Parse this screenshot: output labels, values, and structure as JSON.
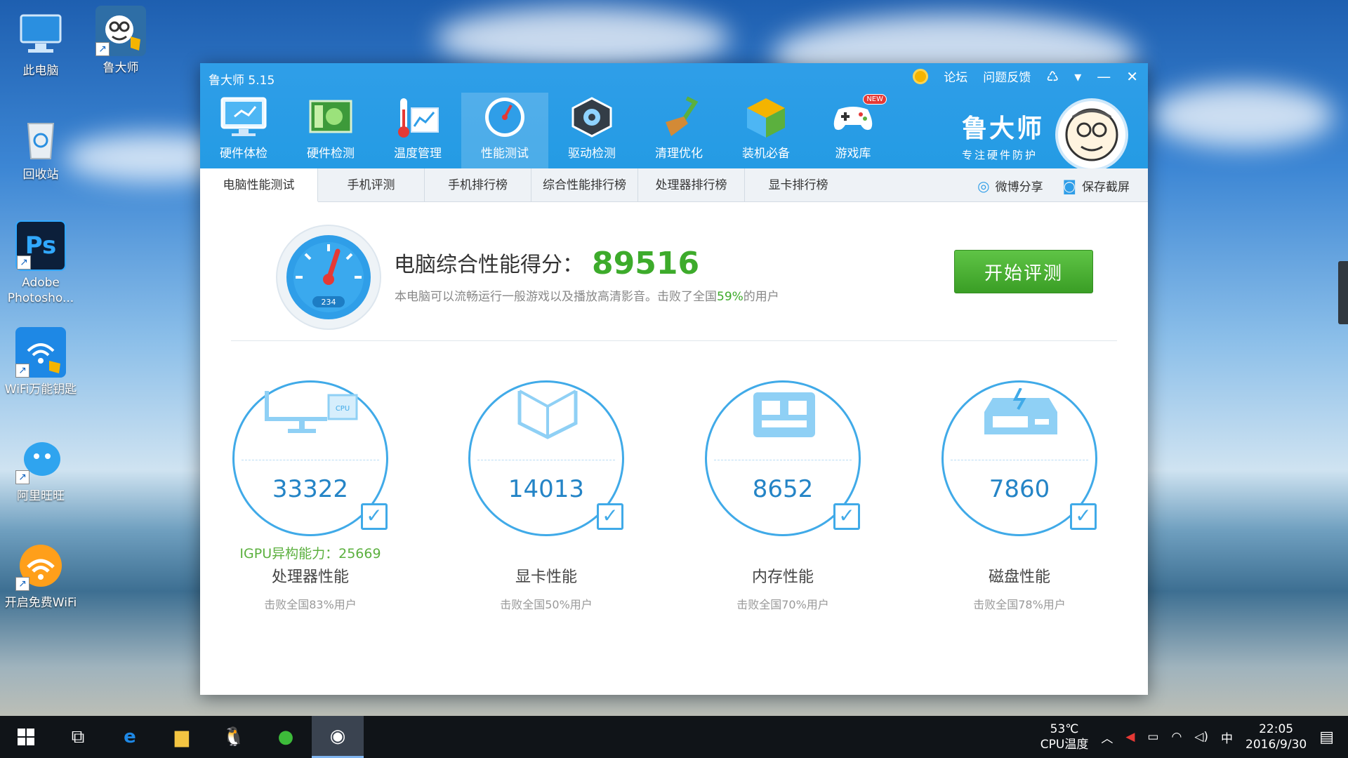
{
  "desktop": {
    "icons": [
      {
        "label": "此电脑"
      },
      {
        "label": "鲁大师"
      },
      {
        "label": "回收站"
      },
      {
        "label": "Adobe Photosho..."
      },
      {
        "label": "WiFi万能钥匙"
      },
      {
        "label": "阿里旺旺"
      },
      {
        "label": "开启免费WiFi"
      }
    ]
  },
  "window": {
    "title": "鲁大师 5.15",
    "header_links": {
      "forum": "论坛",
      "feedback": "问题反馈"
    },
    "toolbar": [
      {
        "label": "硬件体检",
        "icon": "monitor-check-icon"
      },
      {
        "label": "硬件检测",
        "icon": "circuit-board-icon"
      },
      {
        "label": "温度管理",
        "icon": "thermometer-icon"
      },
      {
        "label": "性能测试",
        "icon": "speedometer-icon"
      },
      {
        "label": "驱动检测",
        "icon": "gear-chip-icon"
      },
      {
        "label": "清理优化",
        "icon": "broom-icon"
      },
      {
        "label": "装机必备",
        "icon": "cube-box-icon"
      },
      {
        "label": "游戏库",
        "icon": "gamepad-icon",
        "badge": "NEW"
      }
    ],
    "brand": {
      "name": "鲁大师",
      "slogan": "专注硬件防护"
    },
    "tabs": [
      "电脑性能测试",
      "手机评测",
      "手机排行榜",
      "综合性能排行榜",
      "处理器排行榜",
      "显卡排行榜"
    ],
    "tab_actions": {
      "share": "微博分享",
      "screenshot": "保存截屏"
    },
    "score": {
      "gauge_label": "234",
      "title": "电脑综合性能得分：",
      "value": "89516",
      "desc_before": "本电脑可以流畅运行一般游戏以及播放高清影音。击败了全国",
      "desc_pct": "59%",
      "desc_after": "的用户",
      "start_button": "开始评测"
    },
    "cards": [
      {
        "score": "33322",
        "extra": "IGPU异构能力：25669",
        "name": "处理器性能",
        "desc": "击败全国83%用户",
        "icon": "cpu-monitor-icon"
      },
      {
        "score": "14013",
        "extra": "",
        "name": "显卡性能",
        "desc": "击败全国50%用户",
        "icon": "graphics-cube-icon"
      },
      {
        "score": "8652",
        "extra": "",
        "name": "内存性能",
        "desc": "击败全国70%用户",
        "icon": "memory-chip-icon"
      },
      {
        "score": "7860",
        "extra": "",
        "name": "磁盘性能",
        "desc": "击败全国78%用户",
        "icon": "disk-drive-icon"
      }
    ]
  },
  "taskbar": {
    "cpu_temp": "53℃",
    "cpu_temp_label": "CPU温度",
    "ime": "中",
    "time": "22:05",
    "date": "2016/9/30"
  }
}
